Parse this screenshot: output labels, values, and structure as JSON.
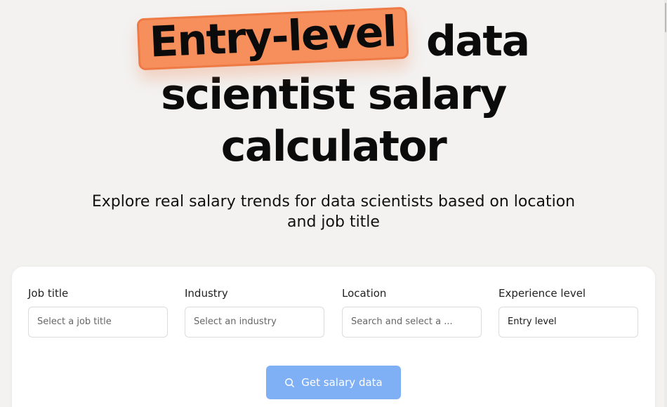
{
  "hero": {
    "highlight": "Entry-level",
    "title_line1_rest": "data",
    "title_line2": "scientist salary",
    "title_line3": "calculator",
    "subtitle_line1": "Explore real salary trends for data scientists based on location",
    "subtitle_line2": "and job title"
  },
  "form": {
    "job_title": {
      "label": "Job title",
      "placeholder": "Select a job title",
      "value": ""
    },
    "industry": {
      "label": "Industry",
      "placeholder": "Select an industry",
      "value": ""
    },
    "location": {
      "label": "Location",
      "placeholder": "Search and select a ...",
      "value": ""
    },
    "experience": {
      "label": "Experience level",
      "value": "Entry level"
    },
    "submit_label": "Get salary data",
    "submit_icon": "search-icon"
  },
  "colors": {
    "background": "#f3f2f1",
    "highlight": "#f78f5c",
    "button": "#7fb0f5"
  }
}
